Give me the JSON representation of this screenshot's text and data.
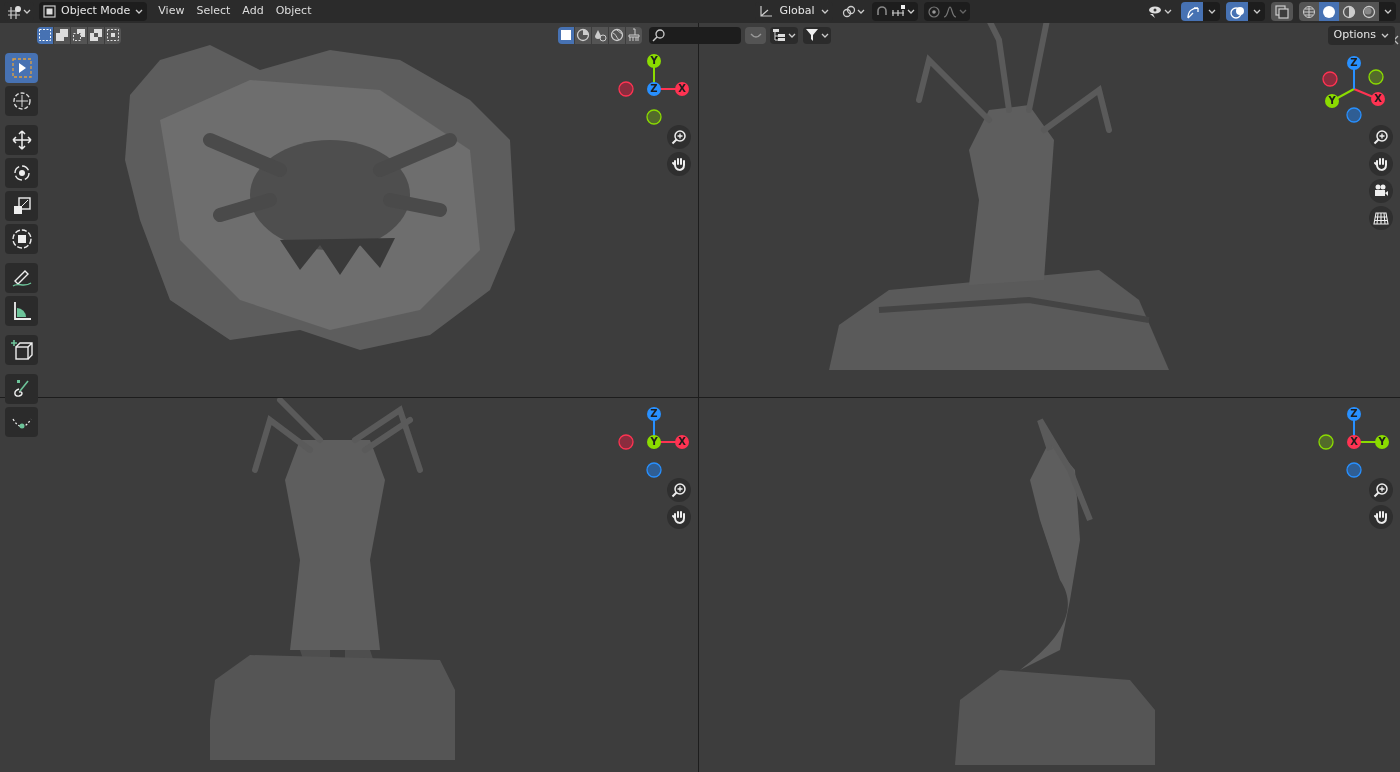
{
  "header": {
    "mode": "Object Mode",
    "menus": [
      "View",
      "Select",
      "Add",
      "Object"
    ],
    "orientation": "Global",
    "options": "Options",
    "toggles": [
      {
        "kind": "gizmos",
        "on": true
      },
      {
        "kind": "overlays",
        "on": true
      },
      {
        "kind": "xray",
        "on": false
      }
    ],
    "shading": [
      {
        "kind": "wireframe",
        "selected": false
      },
      {
        "kind": "solid",
        "selected": true
      },
      {
        "kind": "material",
        "selected": false
      },
      {
        "kind": "rendered",
        "selected": false
      }
    ],
    "select_modes": [
      {
        "kind": "set",
        "selected": true
      },
      {
        "kind": "extend",
        "selected": false
      },
      {
        "kind": "subtract",
        "selected": false
      },
      {
        "kind": "invert",
        "selected": false
      },
      {
        "kind": "intersect",
        "selected": false
      }
    ],
    "filters": [
      {
        "kind": "object",
        "selected": true
      },
      {
        "kind": "material",
        "selected": false
      },
      {
        "kind": "fluid",
        "selected": false
      },
      {
        "kind": "world",
        "selected": false
      },
      {
        "kind": "brush",
        "selected": false
      }
    ]
  },
  "toolbar": [
    {
      "kind": "select",
      "selected": true
    },
    {
      "kind": "cursor",
      "selected": false
    },
    {
      "kind": "move",
      "selected": false
    },
    {
      "kind": "rotate",
      "selected": false
    },
    {
      "kind": "scale",
      "selected": false
    },
    {
      "kind": "transform",
      "selected": false
    },
    {
      "kind": "annotate",
      "selected": false
    },
    {
      "kind": "measure",
      "selected": false
    },
    {
      "kind": "add-cube",
      "selected": false
    },
    {
      "kind": "sculpt",
      "selected": false
    },
    {
      "kind": "curve",
      "selected": false
    }
  ],
  "viewports": [
    {
      "kind": "top",
      "axes": [
        "X",
        "Y",
        "Z"
      ],
      "nav": [
        {
          "kind": "zoom"
        },
        {
          "kind": "pan"
        }
      ]
    },
    {
      "kind": "user",
      "axes": [
        "X",
        "Y",
        "Z"
      ],
      "nav": [
        {
          "kind": "zoom"
        },
        {
          "kind": "pan"
        },
        {
          "kind": "camera"
        },
        {
          "kind": "grid"
        }
      ]
    },
    {
      "kind": "front",
      "axes": [
        "X",
        "Y",
        "Z"
      ],
      "nav": [
        {
          "kind": "zoom"
        },
        {
          "kind": "pan"
        }
      ]
    },
    {
      "kind": "right",
      "axes": [
        "X",
        "Y",
        "Z"
      ],
      "nav": [
        {
          "kind": "zoom"
        },
        {
          "kind": "pan"
        }
      ]
    }
  ]
}
